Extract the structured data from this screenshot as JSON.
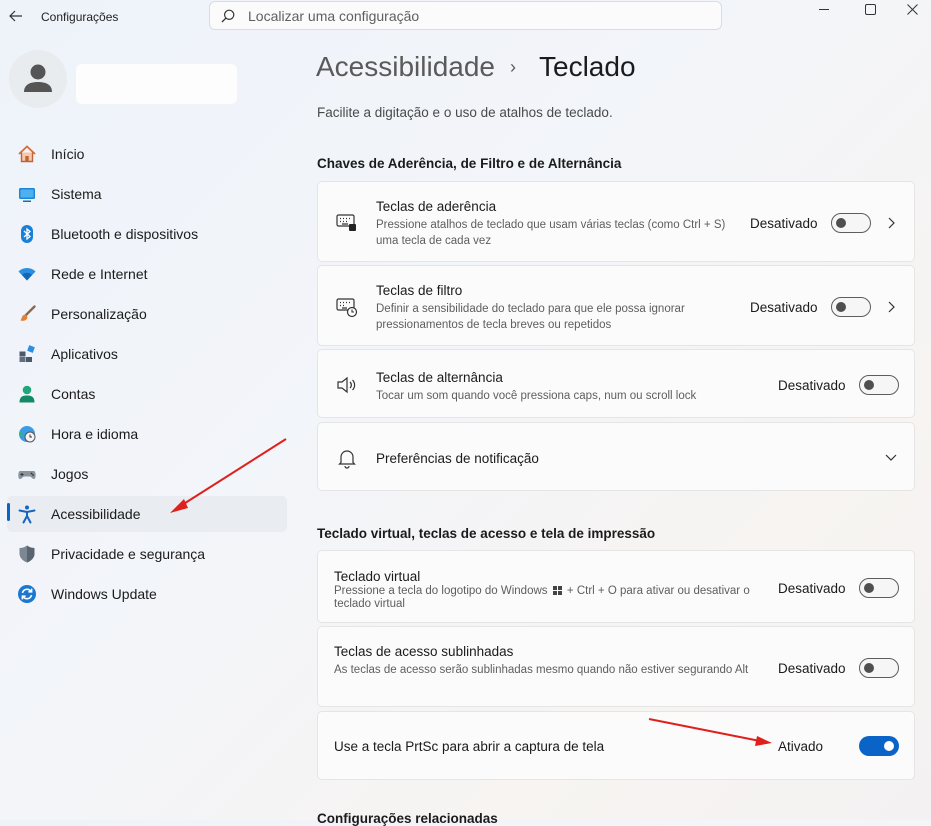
{
  "window": {
    "title": "Configurações"
  },
  "search": {
    "placeholder": "Localizar uma configuração"
  },
  "sidebar": {
    "items": [
      {
        "label": "Início",
        "icon": "home-icon"
      },
      {
        "label": "Sistema",
        "icon": "system-icon"
      },
      {
        "label": "Bluetooth e dispositivos",
        "icon": "bluetooth-icon"
      },
      {
        "label": "Rede e Internet",
        "icon": "wifi-icon"
      },
      {
        "label": "Personalização",
        "icon": "brush-icon"
      },
      {
        "label": "Aplicativos",
        "icon": "apps-icon"
      },
      {
        "label": "Contas",
        "icon": "account-icon"
      },
      {
        "label": "Hora e idioma",
        "icon": "clock-globe-icon"
      },
      {
        "label": "Jogos",
        "icon": "gamepad-icon"
      },
      {
        "label": "Acessibilidade",
        "icon": "accessibility-icon",
        "selected": true
      },
      {
        "label": "Privacidade e segurança",
        "icon": "shield-icon"
      },
      {
        "label": "Windows Update",
        "icon": "update-icon"
      }
    ]
  },
  "breadcrumb": {
    "parent": "Acessibilidade",
    "separator": "›",
    "current": "Teclado"
  },
  "page": {
    "description": "Facilite a digitação e o uso de atalhos de teclado."
  },
  "sections": [
    {
      "title": "Chaves de Aderência, de Filtro e de Alternância",
      "cards": [
        {
          "title": "Teclas de aderência",
          "description": "Pressione atalhos de teclado que usam várias teclas (como Ctrl + S) uma tecla de cada vez",
          "status": "Desativado",
          "enabled": false,
          "icon": "sticky-keys-icon"
        },
        {
          "title": "Teclas de filtro",
          "description": "Definir a sensibilidade do teclado para que ele possa ignorar pressionamentos de tecla breves ou repetidos",
          "status": "Desativado",
          "enabled": false,
          "icon": "filter-keys-icon"
        },
        {
          "title": "Teclas de alternância",
          "description": "Tocar um som quando você pressiona caps, num ou scroll lock",
          "status": "Desativado",
          "enabled": false,
          "icon": "speaker-icon"
        },
        {
          "title": "Preferências de notificação",
          "icon": "bell-icon"
        }
      ]
    },
    {
      "title": "Teclado virtual, teclas de acesso e tela de impressão",
      "cards": [
        {
          "title": "Teclado virtual",
          "description_before": "Pressione a tecla do logotipo do Windows",
          "description_after": "+ Ctrl + O para ativar ou desativar o teclado virtual",
          "status": "Desativado",
          "enabled": false
        },
        {
          "title": "Teclas de acesso sublinhadas",
          "description": "As teclas de acesso serão sublinhadas mesmo quando não estiver segurando Alt",
          "status": "Desativado",
          "enabled": false
        },
        {
          "title": "Use a tecla PrtSc para abrir a captura de tela",
          "status": "Ativado",
          "enabled": true
        }
      ]
    },
    {
      "title": "Configurações relacionadas"
    }
  ],
  "colors": {
    "accent": "#0a63c6",
    "annotation_arrow": "#e0201c"
  }
}
